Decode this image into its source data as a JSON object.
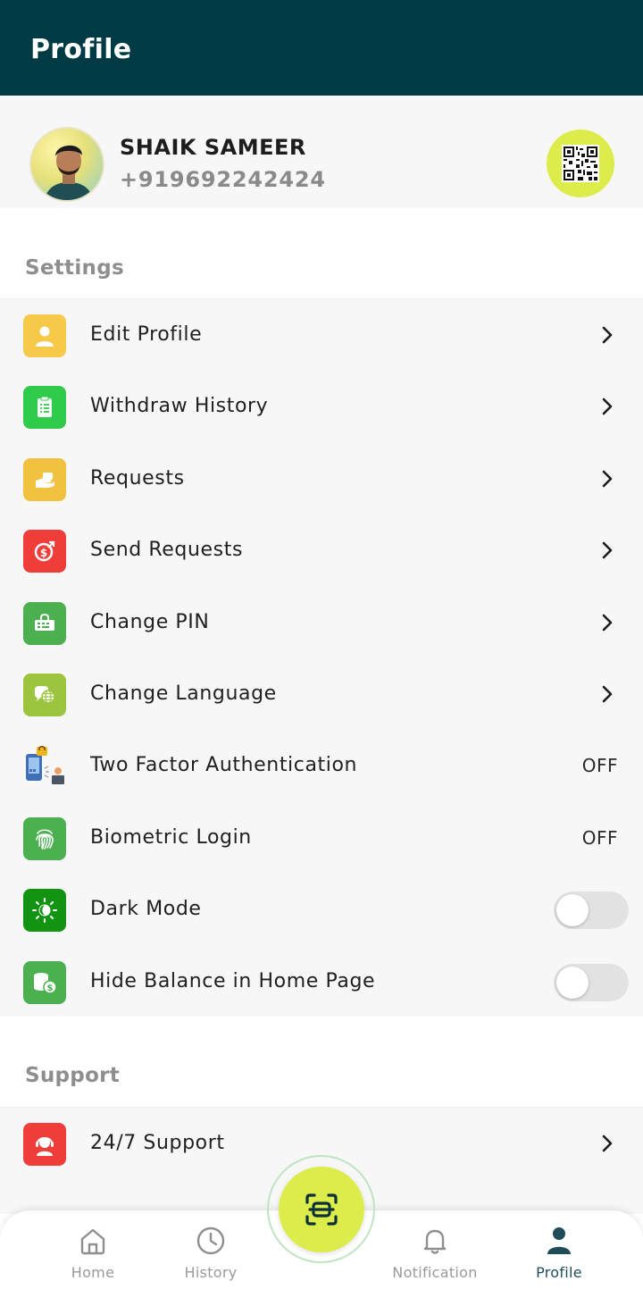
{
  "header": {
    "title": "Profile"
  },
  "profile": {
    "name": "SHAIK SAMEER",
    "phone": "+919692242424"
  },
  "sections": {
    "settings": {
      "label": "Settings",
      "items": [
        {
          "label": "Edit Profile",
          "icon": "user-icon",
          "color": "#f7c948",
          "control": "chevron"
        },
        {
          "label": "Withdraw History",
          "icon": "checklist-icon",
          "color": "#2ecc4a",
          "control": "chevron"
        },
        {
          "label": "Requests",
          "icon": "request-hand-icon",
          "color": "#f2c13f",
          "control": "chevron"
        },
        {
          "label": "Send Requests",
          "icon": "send-money-icon",
          "color": "#ef3e3a",
          "control": "chevron"
        },
        {
          "label": "Change PIN",
          "icon": "pin-keypad-icon",
          "color": "#4caf50",
          "control": "chevron"
        },
        {
          "label": "Change Language",
          "icon": "language-globe-icon",
          "color": "#9cc43f",
          "control": "chevron"
        },
        {
          "label": "Two Factor Authentication",
          "icon": "two-factor-icon",
          "control": "status",
          "status": "OFF"
        },
        {
          "label": "Biometric Login",
          "icon": "fingerprint-icon",
          "color": "#4caf50",
          "control": "status",
          "status": "OFF"
        },
        {
          "label": "Dark Mode",
          "icon": "dark-mode-icon",
          "color": "#129412",
          "control": "toggle",
          "on": false
        },
        {
          "label": "Hide Balance in Home Page",
          "icon": "coins-icon",
          "color": "#4caf50",
          "control": "toggle",
          "on": false
        }
      ]
    },
    "support": {
      "label": "Support",
      "items": [
        {
          "label": "24/7 Support",
          "icon": "support-agent-icon",
          "color": "#ef3e3a",
          "control": "chevron"
        }
      ]
    }
  },
  "bottom_nav": {
    "items": [
      {
        "label": "Home",
        "icon": "home-icon"
      },
      {
        "label": "History",
        "icon": "clock-icon"
      },
      {
        "label": "Notification",
        "icon": "bell-icon"
      },
      {
        "label": "Profile",
        "icon": "profile-icon",
        "active": true
      }
    ],
    "scan_icon": "scan-icon"
  },
  "colors": {
    "header": "#003a45",
    "accent": "#dcec4a",
    "active_nav": "#1e4d59"
  }
}
